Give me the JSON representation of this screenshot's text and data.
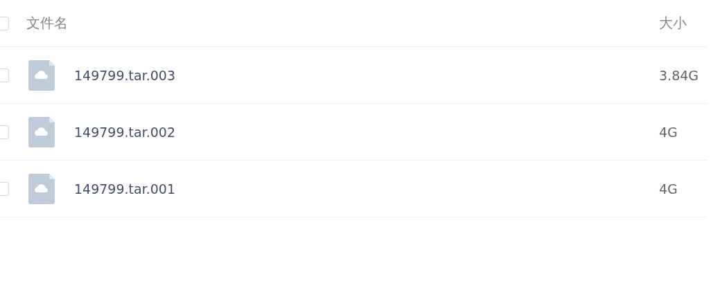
{
  "header": {
    "checked": false,
    "columns": [
      "文件名",
      "大小"
    ]
  },
  "files": [
    {
      "name": "149799.tar.003",
      "size": "3.84G",
      "checked": false
    },
    {
      "name": "149799.tar.002",
      "size": "4G",
      "checked": false
    },
    {
      "name": "149799.tar.001",
      "size": "4G",
      "checked": false
    }
  ]
}
